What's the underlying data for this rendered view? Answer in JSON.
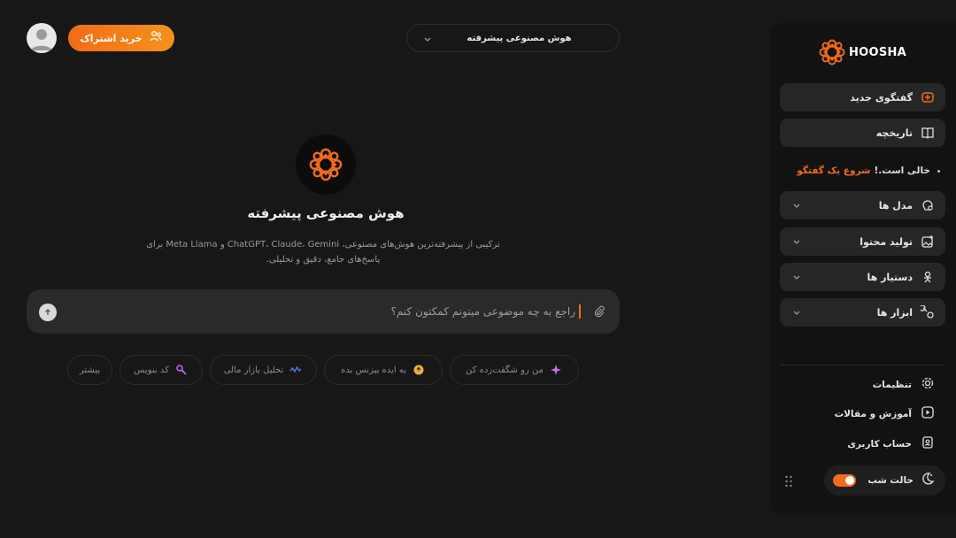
{
  "sidebar": {
    "brand": "HOOSHA",
    "new_chat": "گفتگوی جدید",
    "history": "تاریخچه",
    "empty_text": "خالی است.!",
    "empty_link": "شروع یک گفتگو",
    "menus": [
      {
        "label": "مدل ها"
      },
      {
        "label": "تولید محتوا"
      },
      {
        "label": "دستیار ها"
      },
      {
        "label": "ابزار ها"
      }
    ],
    "links": [
      {
        "label": "تنظیمات"
      },
      {
        "label": "آموزش و مقالات"
      },
      {
        "label": "حساب کاربری"
      }
    ],
    "night_mode": "حالت شب"
  },
  "header": {
    "buy_label": "خرید اشتراک",
    "model_label": "هوش مصنوعی پیشرفته"
  },
  "hero": {
    "title": "هوش مصنوعی پیشرفته",
    "desc_line1": "ترکیبی از پیشرفته‌ترین هوش‌های مصنوعی، ChatGPT، Claude، Gemini و Meta Llama برای",
    "desc_line2": "پاسخ‌های جامع، دقیق و تحلیلی."
  },
  "chat": {
    "placeholder": "راجع به چه موضوعی میتونم کمکتون کنم؟"
  },
  "chips": [
    {
      "label": "من رو شگفت‌زده کن"
    },
    {
      "label": "یه ایده بیزنس بده"
    },
    {
      "label": "تحلیل بازار مالی"
    },
    {
      "label": "کد بنویس"
    },
    {
      "label": "بیشتر"
    }
  ],
  "colors": {
    "accent": "#f26a1b",
    "background": "#171717",
    "sidebar": "#121212"
  }
}
